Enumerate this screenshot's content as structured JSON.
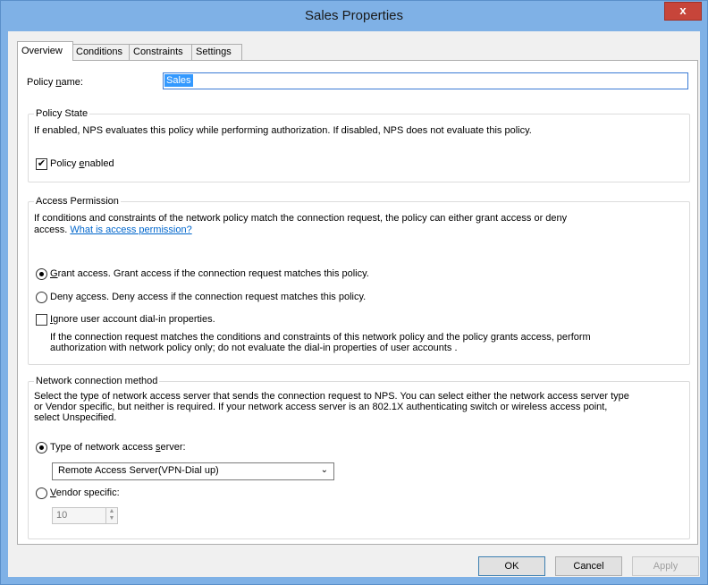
{
  "window": {
    "title": "Sales Properties",
    "close_label": "x"
  },
  "tabs": [
    "Overview",
    "Conditions",
    "Constraints",
    "Settings"
  ],
  "policy_name": {
    "label_pre": "Policy ",
    "label_u": "n",
    "label_post": "ame:",
    "value": "Sales"
  },
  "policy_state": {
    "title": "Policy State",
    "description": "If enabled, NPS evaluates this policy while performing authorization. If disabled, NPS does not evaluate this policy.",
    "enabled": {
      "label_pre": "Policy ",
      "label_u": "e",
      "label_post": "nabled",
      "checked": true
    }
  },
  "access_permission": {
    "title": "Access Permission",
    "description_line1": "If conditions and constraints of the network policy match the connection request, the policy can either grant access or deny",
    "description_line2": "access.",
    "link": "What is access permission?",
    "grant": {
      "label_u": "G",
      "label_post": "rant access. Grant access if the connection request matches this policy.",
      "selected": true
    },
    "deny": {
      "label_pre": "Deny a",
      "label_u": "c",
      "label_post": "cess. Deny access if the connection request matches this policy.",
      "selected": false
    },
    "ignore": {
      "label_u": "I",
      "label_post": "gnore user account dial-in properties.",
      "checked": false
    },
    "ignore_desc_line1": "If the connection request matches the conditions and constraints of this network policy and the policy grants access, perform",
    "ignore_desc_line2": "authorization with network policy only; do not evaluate the dial-in properties of user accounts ."
  },
  "connection_method": {
    "title": "Network connection method",
    "desc_line1": "Select the type of network access server that sends the connection request to NPS. You can select either the network access server type",
    "desc_line2": "or Vendor specific, but neither is required.  If your network access server is an 802.1X authenticating switch or wireless access point,",
    "desc_line3": "select Unspecified.",
    "type": {
      "label_pre": "Type of network access ",
      "label_u": "s",
      "label_post": "erver:",
      "selected": true
    },
    "type_value": "Remote Access Server(VPN-Dial up)",
    "vendor": {
      "label_u": "V",
      "label_post": "endor specific:",
      "selected": false
    },
    "vendor_value": "10"
  },
  "buttons": {
    "ok": "OK",
    "cancel": "Cancel",
    "apply": "Apply"
  },
  "icons": {
    "check": "✔",
    "dropdown": "chevron-down-icon",
    "spin_up": "▲",
    "spin_down": "▼"
  },
  "colors": {
    "titlebar": "#7fb1e6",
    "close": "#c7453a",
    "selection": "#3399ff",
    "link": "#0066cc"
  }
}
